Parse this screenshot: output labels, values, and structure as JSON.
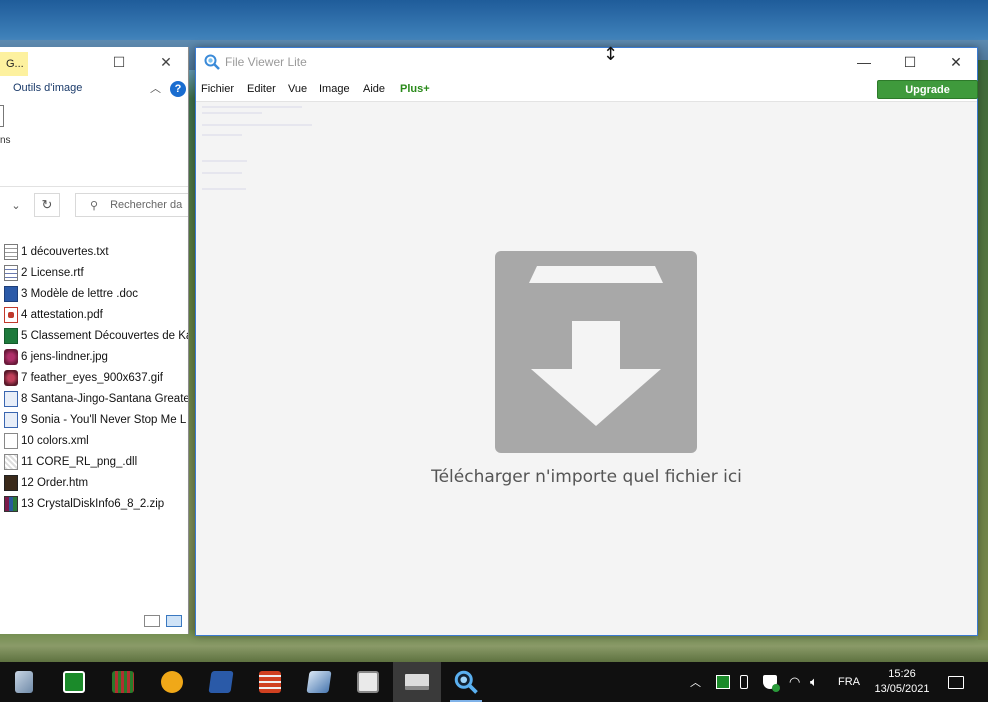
{
  "explorer": {
    "tab_g": "G...",
    "ribbon_tab": "Outils d'image",
    "help": "?",
    "ribbon_text": "ns",
    "search_placeholder": "Rechercher da",
    "files": [
      {
        "name": "1 découvertes.txt",
        "icon": "txt-file-icon"
      },
      {
        "name": "2 License.rtf",
        "icon": "rtf-file-icon"
      },
      {
        "name": "3 Modèle de lettre .doc",
        "icon": "word-file-icon"
      },
      {
        "name": "4 attestation.pdf",
        "icon": "pdf-file-icon"
      },
      {
        "name": "5 Classement Découvertes de Ka",
        "icon": "excel-file-icon"
      },
      {
        "name": "6 jens-lindner.jpg",
        "icon": "image-file-icon"
      },
      {
        "name": "7 feather_eyes_900x637.gif",
        "icon": "gif-file-icon"
      },
      {
        "name": "8 Santana-Jingo-Santana Greate",
        "icon": "audio-file-icon"
      },
      {
        "name": "9 Sonia - You'll Never Stop Me L",
        "icon": "music-file-icon"
      },
      {
        "name": "10 colors.xml",
        "icon": "xml-file-icon"
      },
      {
        "name": "11 CORE_RL_png_.dll",
        "icon": "dll-file-icon"
      },
      {
        "name": "12 Order.htm",
        "icon": "html-file-icon"
      },
      {
        "name": "13 CrystalDiskInfo6_8_2.zip",
        "icon": "archive-file-icon"
      }
    ]
  },
  "viewer": {
    "title": "File Viewer Lite",
    "menu": [
      "Fichier",
      "Editer",
      "Vue",
      "Image",
      "Aide"
    ],
    "plus": "Plus+",
    "upgrade": "Upgrade",
    "drop_text": "Télécharger n'importe quel fichier ici"
  },
  "taskbar": {
    "language": "FRA",
    "time": "15:26",
    "date": "13/05/2021"
  },
  "colors": {
    "upgrade_green": "#3f9a3c",
    "plus_green": "#2a8a1a",
    "window_border": "#3a7ad0",
    "drop_icon_gray": "#a8a8a8"
  }
}
